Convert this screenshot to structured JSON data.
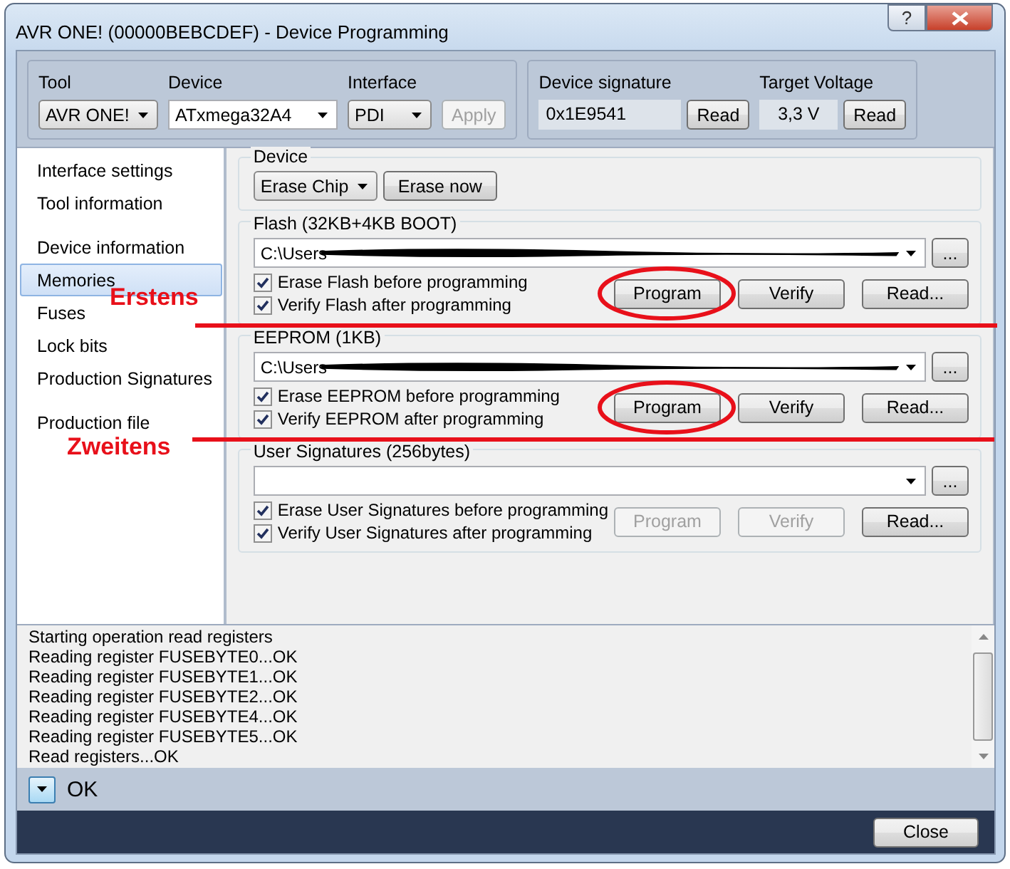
{
  "window": {
    "title": "AVR ONE! (00000BEBCDEF) - Device Programming",
    "help_button": "?"
  },
  "toolbar": {
    "tool": {
      "label": "Tool",
      "value": "AVR ONE!"
    },
    "device": {
      "label": "Device",
      "value": "ATxmega32A4"
    },
    "interface": {
      "label": "Interface",
      "value": "PDI"
    },
    "apply": {
      "label": "Apply",
      "disabled": true
    },
    "signature": {
      "label": "Device signature",
      "value": "0x1E9541",
      "button": "Read"
    },
    "voltage": {
      "label": "Target Voltage",
      "value": "3,3 V",
      "button": "Read"
    }
  },
  "sidebar": {
    "groups": [
      [
        {
          "label": "Interface settings",
          "selected": false
        },
        {
          "label": "Tool information",
          "selected": false
        }
      ],
      [
        {
          "label": "Device information",
          "selected": false
        },
        {
          "label": "Memories",
          "selected": true
        },
        {
          "label": "Fuses",
          "selected": false
        },
        {
          "label": "Lock bits",
          "selected": false
        },
        {
          "label": "Production Signatures",
          "selected": false
        }
      ],
      [
        {
          "label": "Production file",
          "selected": false
        }
      ]
    ]
  },
  "device_section": {
    "title": "Device",
    "erase_mode": "Erase Chip",
    "button": "Erase now"
  },
  "annotations": [
    {
      "kind": "text",
      "text": "Erstens"
    },
    {
      "kind": "line"
    },
    {
      "kind": "text",
      "text": "Zweitens"
    },
    {
      "kind": "line"
    }
  ],
  "memories": [
    {
      "title": "Flash (32KB+4KB BOOT)",
      "path": "C:\\Users",
      "redacted": true,
      "browse_button": "...",
      "options": [
        {
          "label": "Erase Flash before programming",
          "checked": true
        },
        {
          "label": "Verify Flash after programming",
          "checked": true
        }
      ],
      "buttons": [
        {
          "label": "Program",
          "disabled": false,
          "circled": true
        },
        {
          "label": "Verify",
          "disabled": false,
          "circled": false
        },
        {
          "label": "Read...",
          "disabled": false,
          "circled": false
        }
      ]
    },
    {
      "title": "EEPROM (1KB)",
      "path": "C:\\Users",
      "redacted": true,
      "browse_button": "...",
      "options": [
        {
          "label": "Erase EEPROM before programming",
          "checked": true
        },
        {
          "label": "Verify EEPROM after programming",
          "checked": true
        }
      ],
      "buttons": [
        {
          "label": "Program",
          "disabled": false,
          "circled": true
        },
        {
          "label": "Verify",
          "disabled": false,
          "circled": false
        },
        {
          "label": "Read...",
          "disabled": false,
          "circled": false
        }
      ]
    },
    {
      "title": "User Signatures (256bytes)",
      "browse_button": "...",
      "options": [
        {
          "label": "Erase User Signatures before programming",
          "checked": true
        },
        {
          "label": "Verify User Signatures after programming",
          "checked": true
        }
      ],
      "buttons": [
        {
          "label": "Program",
          "disabled": true,
          "circled": false
        },
        {
          "label": "Verify",
          "disabled": true,
          "circled": false
        },
        {
          "label": "Read...",
          "disabled": false,
          "circled": false
        }
      ]
    }
  ],
  "log": {
    "lines": [
      "Starting operation read registers",
      "Reading register FUSEBYTE0...OK",
      "Reading register FUSEBYTE1...OK",
      "Reading register FUSEBYTE2...OK",
      "Reading register FUSEBYTE4...OK",
      "Reading register FUSEBYTE5...OK",
      "Read registers...OK"
    ]
  },
  "status": {
    "text": "OK"
  },
  "footer": {
    "close_button": "Close"
  }
}
